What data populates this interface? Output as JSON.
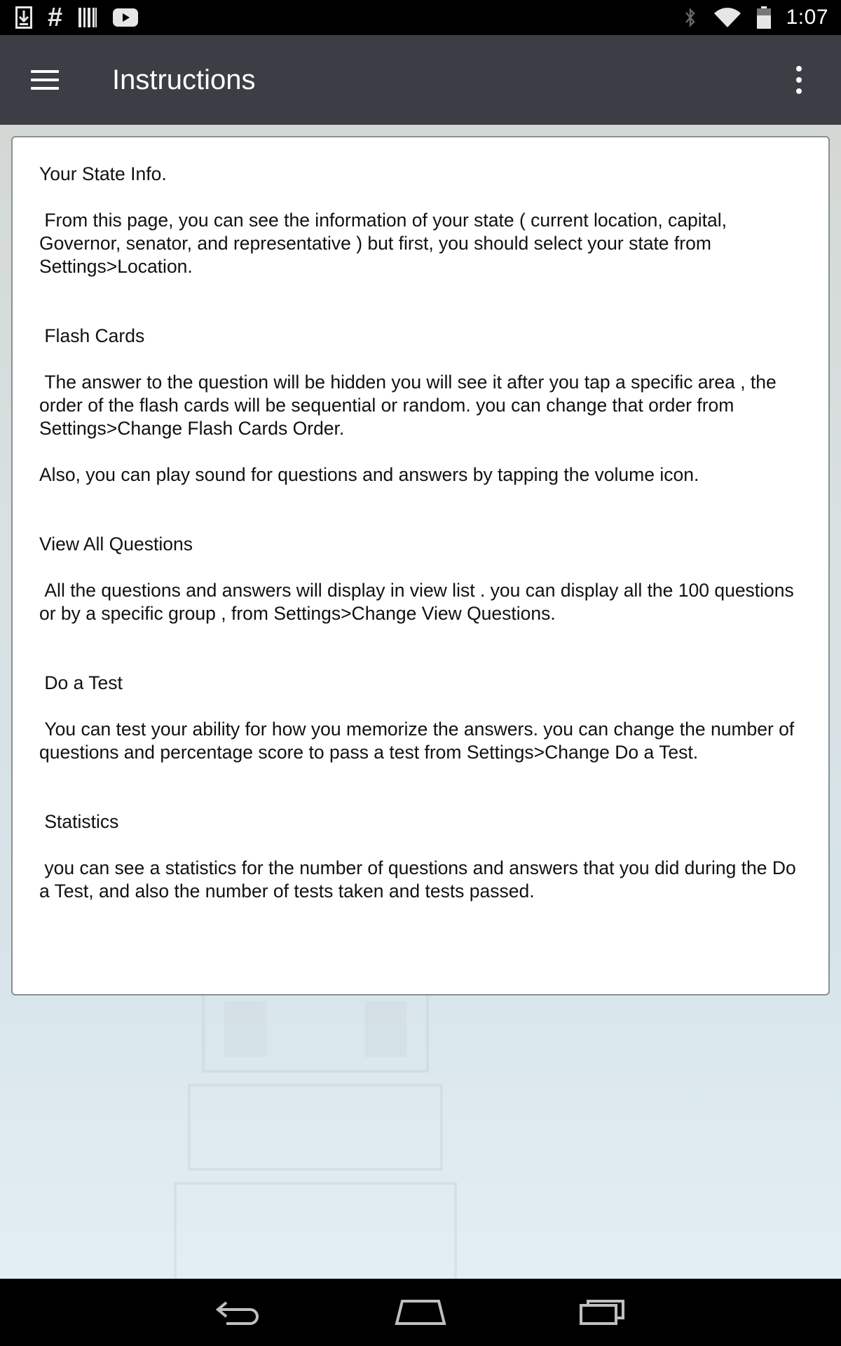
{
  "status_bar": {
    "time": "1:07",
    "left_icons": [
      "download-icon",
      "hash-icon",
      "barcode-icon",
      "youtube-icon"
    ],
    "right_icons": [
      "bluetooth-icon",
      "wifi-icon",
      "battery-icon"
    ]
  },
  "app_bar": {
    "title": "Instructions",
    "menu_icon": "hamburger-menu-icon",
    "overflow_icon": "more-vert-icon"
  },
  "instructions": {
    "state_info_title": "Your State Info.",
    "state_info_body": " From this page, you can see the information of your state ( current location, capital, Governor, senator, and representative ) but first, you should select your state from Settings>Location.",
    "flash_cards_title": " Flash Cards",
    "flash_cards_body": " The answer to the question will be hidden you will see it after you tap a specific area , the order of the flash cards will be sequential or random. you can change that order from Settings>Change Flash Cards Order.",
    "flash_cards_body2": "Also, you can play sound for questions and answers by tapping the volume icon.",
    "view_all_title": "View All Questions",
    "view_all_body": " All the questions and answers will display in view list . you can display all the 100 questions or by a specific group , from Settings>Change View Questions.",
    "do_test_title": " Do a Test",
    "do_test_body": " You can test your ability for how you memorize the answers. you can change the number of questions and percentage score to pass a test from Settings>Change Do a Test.",
    "statistics_title": " Statistics",
    "statistics_body": " you can see a statistics for the number of questions and answers that you did during the Do a Test, and also the number of tests taken and tests passed."
  },
  "nav_bar": {
    "icons": [
      "back-icon",
      "home-icon",
      "recent-apps-icon"
    ]
  },
  "colors": {
    "app_bar": "#3c3e45",
    "status_bar": "#000000",
    "card_border": "#8a8f92"
  }
}
